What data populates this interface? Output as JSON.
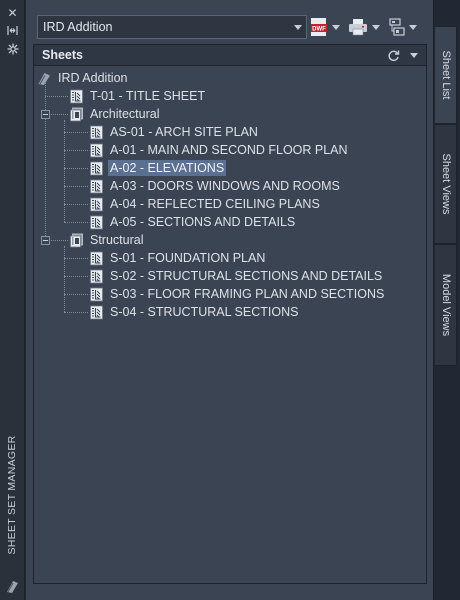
{
  "side_strip": {
    "title": "SHEET SET MANAGER",
    "icons": [
      "close-icon",
      "auto-hide-icon",
      "properties-icon"
    ]
  },
  "toolbar": {
    "sheet_set": "IRD Addition",
    "publish_badge": "DWF"
  },
  "panel": {
    "title": "Sheets"
  },
  "tree": {
    "root": "IRD Addition",
    "title_sheet": "T-01 - TITLE SHEET",
    "groups": [
      {
        "name": "Architectural",
        "sheets": [
          "AS-01 - ARCH SITE PLAN",
          "A-01 - MAIN AND SECOND FLOOR PLAN",
          "A-02 - ELEVATIONS",
          "A-03 - DOORS WINDOWS AND ROOMS",
          "A-04 - REFLECTED CEILING PLANS",
          "A-05 - SECTIONS AND DETAILS"
        ]
      },
      {
        "name": "Structural",
        "sheets": [
          "S-01 - FOUNDATION PLAN",
          "S-02 - STRUCTURAL SECTIONS AND DETAILS",
          "S-03 - FLOOR FRAMING PLAN AND SECTIONS",
          "S-04 - STRUCTURAL SECTIONS"
        ]
      }
    ],
    "selected": "A-02 - ELEVATIONS"
  },
  "tabs": [
    {
      "label": "Sheet List",
      "active": true
    },
    {
      "label": "Sheet Views",
      "active": false
    },
    {
      "label": "Model Views",
      "active": false
    }
  ],
  "colors": {
    "background": "#3b4453",
    "header": "#2f3745",
    "selection": "#5b7090",
    "publish_red": "#c0262d"
  }
}
